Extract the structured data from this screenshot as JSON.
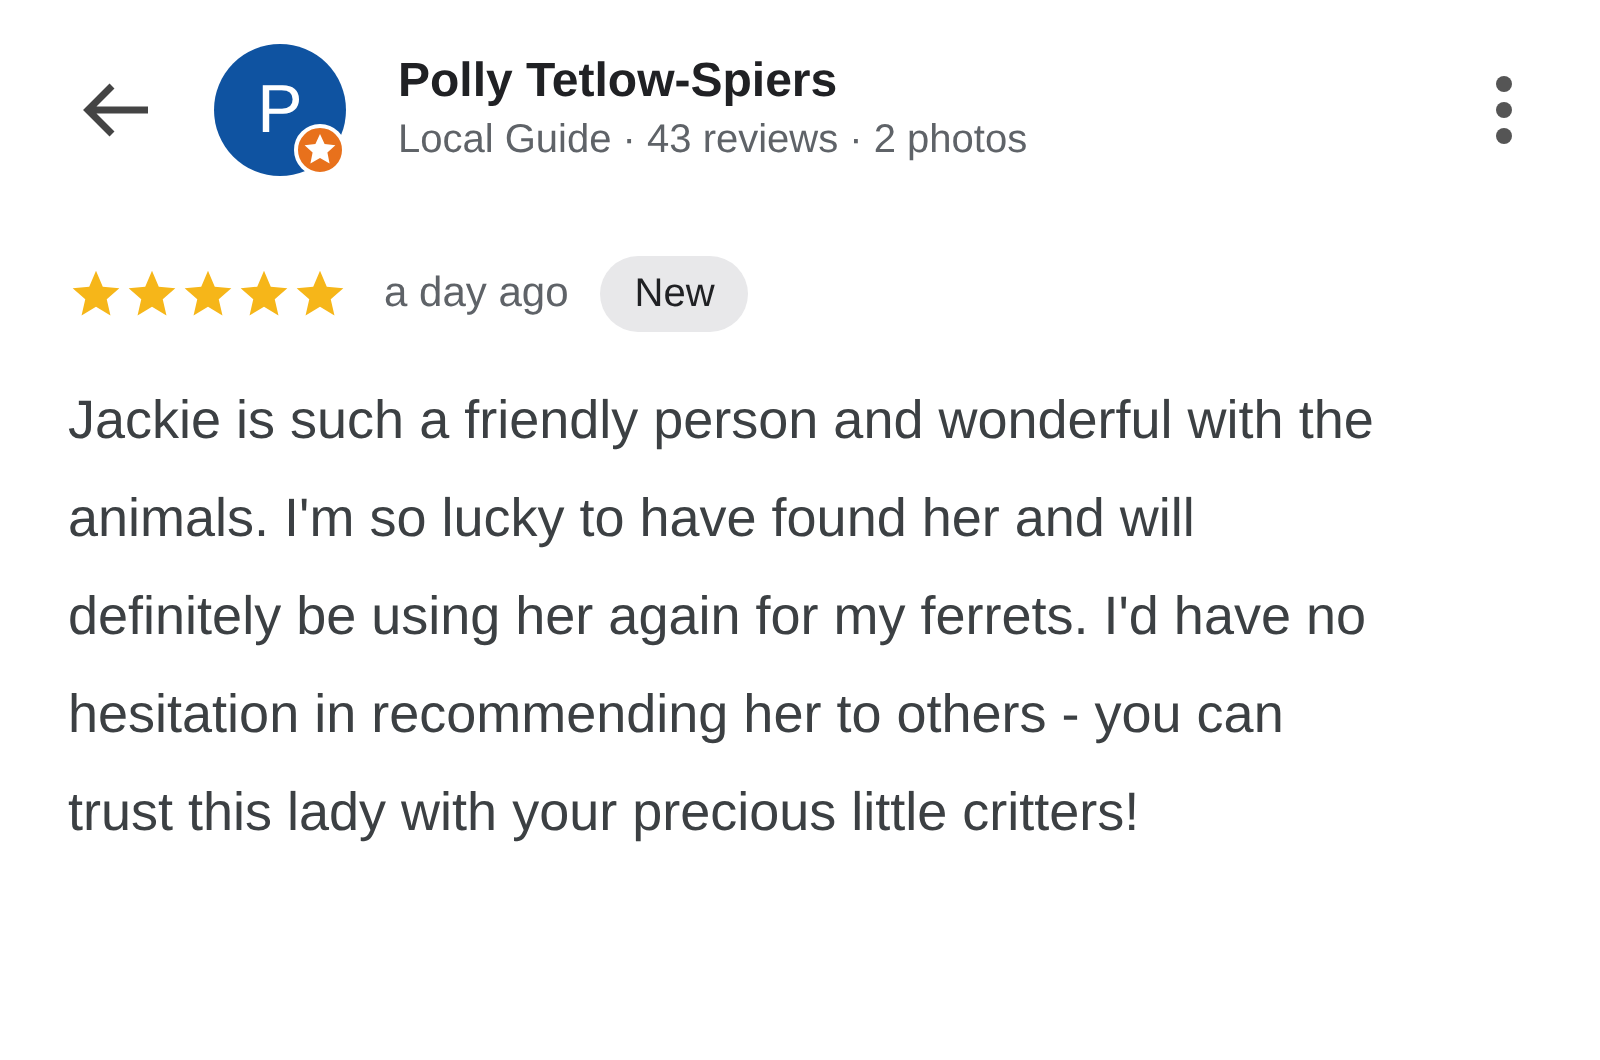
{
  "reviewer": {
    "initial": "P",
    "name": "Polly Tetlow-Spiers",
    "subtitle": "Local Guide · 43 reviews · 2 photos",
    "local_guide": true
  },
  "review": {
    "stars": 5,
    "time": "a day ago",
    "badge": "New",
    "text": "Jackie is such a friendly person and wonderful with the animals. I'm so lucky to have found her and will definitely be using her again for my ferrets. I'd have no hesitation in recommending her to others - you can trust this lady with your precious little critters!"
  }
}
